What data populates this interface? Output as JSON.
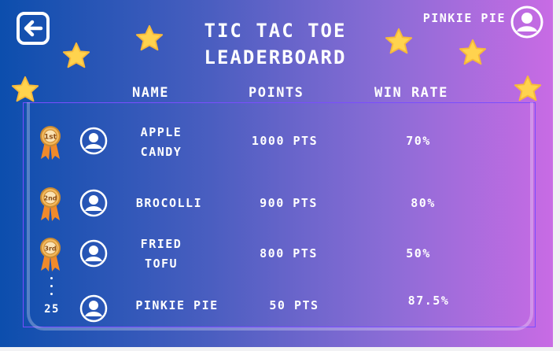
{
  "title_line1": "TIC TAC TOE",
  "title_line2": "LEADERBOARD",
  "player_name": "PiNKiE PiE",
  "columns": {
    "name": "NAME",
    "points": "POiNTS",
    "win_rate": "WiN RATE"
  },
  "rows": [
    {
      "medal": "1st",
      "name_line1": "APPLE",
      "name_line2": "CANDY",
      "points": "1000 PTS",
      "win_rate": "70%"
    },
    {
      "medal": "2nd",
      "name_line1": "BROCOLLi",
      "name_line2": "",
      "points": "900 PTS",
      "win_rate": "80%"
    },
    {
      "medal": "3rd",
      "name_line1": "FRiED",
      "name_line2": "TOFU",
      "points": "800 PTS",
      "win_rate": "50%"
    },
    {
      "rank": "25",
      "name_line1": "PiNKiE PiE",
      "name_line2": "",
      "points": "50 PTS",
      "win_rate": "87.5%"
    }
  ],
  "colors": {
    "gradient_start": "#0c4ead",
    "gradient_end": "#c86be4",
    "star": "#ffd34e",
    "medal": "#f3b75a",
    "ribbon": "#f08a2b"
  },
  "icons": {
    "back": "back-arrow-icon",
    "avatar": "user-avatar-icon",
    "star": "star-icon",
    "medal": "medal-icon"
  }
}
